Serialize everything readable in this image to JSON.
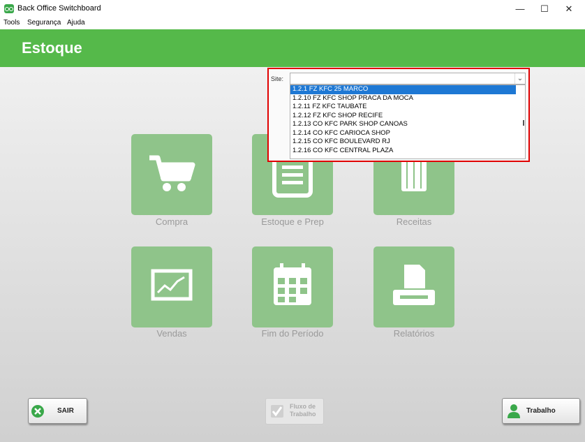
{
  "window": {
    "title": "Back Office Switchboard",
    "minimize": "—",
    "maximize": "☐",
    "close": "✕"
  },
  "menu": {
    "items": [
      "Tools",
      "Segurança",
      "Ajuda"
    ]
  },
  "header": {
    "title": "Estoque"
  },
  "tiles": [
    {
      "label": "Compra",
      "icon": "shopping-cart-icon"
    },
    {
      "label": "Estoque e Prep",
      "icon": "clipboard-icon"
    },
    {
      "label": "Receitas",
      "icon": "chef-hat-icon"
    },
    {
      "label": "Vendas",
      "icon": "chart-icon"
    },
    {
      "label": "Fim do Período",
      "icon": "calendar-icon"
    },
    {
      "label": "Relatórios",
      "icon": "printer-icon"
    }
  ],
  "buttons": {
    "exit": "SAIR",
    "workflow": "Fluxo de Trabalho",
    "work": "Trabalho"
  },
  "site": {
    "label": "Site:",
    "value": "",
    "options": [
      "1.2.1 FZ KFC 25 MARCO",
      "1.2.10 FZ KFC SHOP PRACA DA MOCA",
      "1.2.11 FZ KFC TAUBATE",
      "1.2.12 FZ KFC SHOP RECIFE",
      "1.2.13 CO KFC PARK SHOP CANOAS",
      "1.2.14 CO KFC CARIOCA SHOP",
      "1.2.15 CO KFC BOULEVARD RJ",
      "1.2.16 CO KFC CENTRAL PLAZA"
    ],
    "selected_index": 0
  },
  "colors": {
    "header": "#55b94a",
    "tile": "#8fc48a",
    "highlight": "#e00000",
    "selection": "#1e78d4"
  }
}
